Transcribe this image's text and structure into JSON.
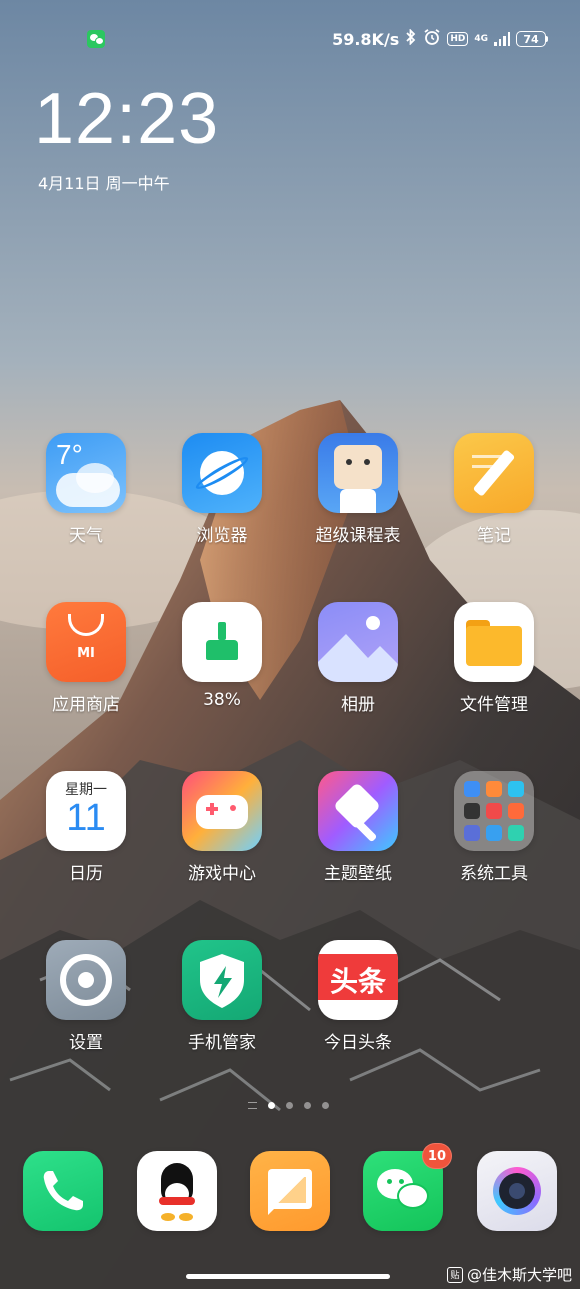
{
  "status_bar": {
    "net_speed": "59.8K/s",
    "network_type": "4G",
    "hd_label": "HD",
    "battery": "74",
    "icons": [
      "wechat-notification-icon",
      "bluetooth-icon",
      "alarm-icon",
      "hd-icon",
      "signal-icon",
      "battery-icon"
    ]
  },
  "lockscreen": {
    "time": "12:23",
    "date": "4月11日 周一中午"
  },
  "apps": [
    {
      "label": "天气",
      "icon": "weather-icon",
      "temp": "7°"
    },
    {
      "label": "浏览器",
      "icon": "browser-icon"
    },
    {
      "label": "超级课程表",
      "icon": "class-schedule-icon"
    },
    {
      "label": "笔记",
      "icon": "notes-icon"
    },
    {
      "label": "应用商店",
      "icon": "app-store-icon",
      "badge_text": "MI"
    },
    {
      "label": "38%",
      "icon": "cleaner-icon"
    },
    {
      "label": "相册",
      "icon": "gallery-icon"
    },
    {
      "label": "文件管理",
      "icon": "file-manager-icon"
    },
    {
      "label": "日历",
      "icon": "calendar-icon",
      "weekday": "星期一",
      "day": "11"
    },
    {
      "label": "游戏中心",
      "icon": "game-center-icon"
    },
    {
      "label": "主题壁纸",
      "icon": "themes-icon"
    },
    {
      "label": "系统工具",
      "icon": "system-tools-folder-icon"
    },
    {
      "label": "设置",
      "icon": "settings-icon"
    },
    {
      "label": "手机管家",
      "icon": "security-icon"
    },
    {
      "label": "今日头条",
      "icon": "toutiao-icon",
      "icon_text": "头条"
    }
  ],
  "dock": [
    {
      "icon": "phone-icon"
    },
    {
      "icon": "qq-icon"
    },
    {
      "icon": "messages-icon"
    },
    {
      "icon": "wechat-icon",
      "badge": "10"
    },
    {
      "icon": "camera-icon"
    }
  ],
  "watermark": "@佳木斯大学吧",
  "colors": {
    "wechat_green": "#2bc760",
    "badge_red": "#f0543c"
  }
}
